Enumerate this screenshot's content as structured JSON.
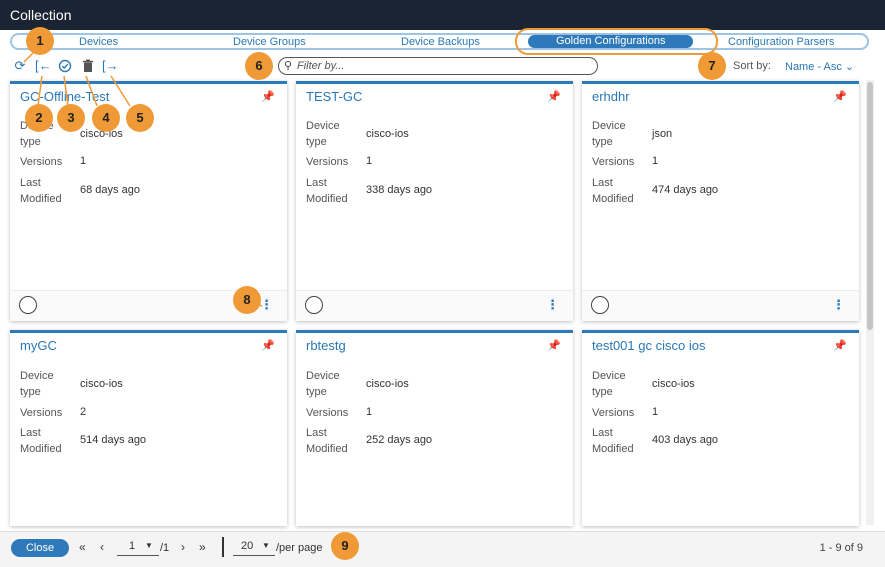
{
  "window": {
    "title": "Collection"
  },
  "tabs": [
    {
      "label": "Devices"
    },
    {
      "label": "Device Groups"
    },
    {
      "label": "Device Backups"
    },
    {
      "label": "Golden Configurations"
    },
    {
      "label": "Configuration Parsers"
    }
  ],
  "toolbar": {
    "icons": [
      "refresh-icon",
      "import-icon",
      "select-all-icon",
      "delete-icon",
      "export-icon"
    ],
    "search_placeholder": "Filter by...",
    "sort_label": "Sort by:",
    "sort_value": "Name - Asc"
  },
  "card_labels": {
    "device_type": "Device type",
    "versions": "Versions",
    "last_modified": "Last Modified"
  },
  "cards": [
    {
      "name": "GC-Offline-Test",
      "device_type": "cisco-ios",
      "versions": "1",
      "last_modified": "68 days ago"
    },
    {
      "name": "TEST-GC",
      "device_type": "cisco-ios",
      "versions": "1",
      "last_modified": "338 days ago"
    },
    {
      "name": "erhdhr",
      "device_type": "json",
      "versions": "1",
      "last_modified": "474 days ago"
    },
    {
      "name": "myGC",
      "device_type": "cisco-ios",
      "versions": "2",
      "last_modified": "514 days ago"
    },
    {
      "name": "rbtestg",
      "device_type": "cisco-ios",
      "versions": "1",
      "last_modified": "252 days ago"
    },
    {
      "name": "test001 gc cisco ios",
      "device_type": "cisco-ios",
      "versions": "1",
      "last_modified": "403 days ago"
    }
  ],
  "footer": {
    "close_label": "Close",
    "first": "«",
    "prev": "‹",
    "next": "›",
    "last": "»",
    "page_value": "1",
    "page_total": "/1",
    "per_page_value": "20",
    "per_page_label": "/per page",
    "range": "1 - 9 of 9"
  },
  "callouts": [
    "1",
    "2",
    "3",
    "4",
    "5",
    "6",
    "7",
    "8",
    "9"
  ],
  "colors": {
    "accent": "#2e79ba",
    "callout": "#f09a37",
    "titlebar": "#1b2433"
  }
}
